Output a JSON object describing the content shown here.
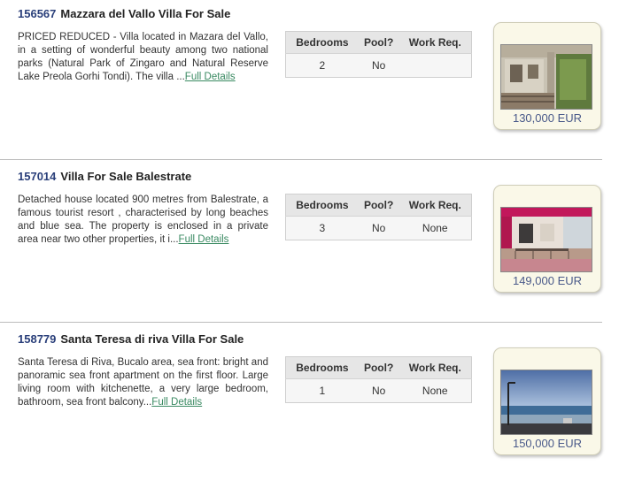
{
  "table_headers": [
    "Bedrooms",
    "Pool?",
    "Work Req."
  ],
  "listings": [
    {
      "ref": "156567",
      "title": "Mazzara del Vallo Villa For Sale",
      "description": "PRICED REDUCED - Villa located in Mazara del Vallo, in a setting of wonderful beauty among two national parks (Natural Park of Zingaro and Natural Reserve Lake Preola Gorhi Tondi). The villa ...",
      "link": "Full Details",
      "bedrooms": "2",
      "pool": "No",
      "work": "",
      "price": "130,000 EUR"
    },
    {
      "ref": "157014",
      "title": "Villa For Sale Balestrate",
      "description": "Detached house located 900 metres from Balestrate, a famous tourist resort , characterised by long beaches and blue sea. The property is enclosed in a private area near two other properties, it i...",
      "link": "Full Details",
      "bedrooms": "3",
      "pool": "No",
      "work": "None",
      "price": "149,000 EUR"
    },
    {
      "ref": "158779",
      "title": "Santa Teresa di riva Villa For Sale",
      "description": "Santa Teresa di Riva, Bucalo area, sea front: bright and panoramic sea front apartment on the first floor. Large living room with kitchenette, a very large bedroom, bathroom, sea front balcony...",
      "link": "Full Details",
      "bedrooms": "1",
      "pool": "No",
      "work": "None",
      "price": "150,000 EUR"
    }
  ]
}
